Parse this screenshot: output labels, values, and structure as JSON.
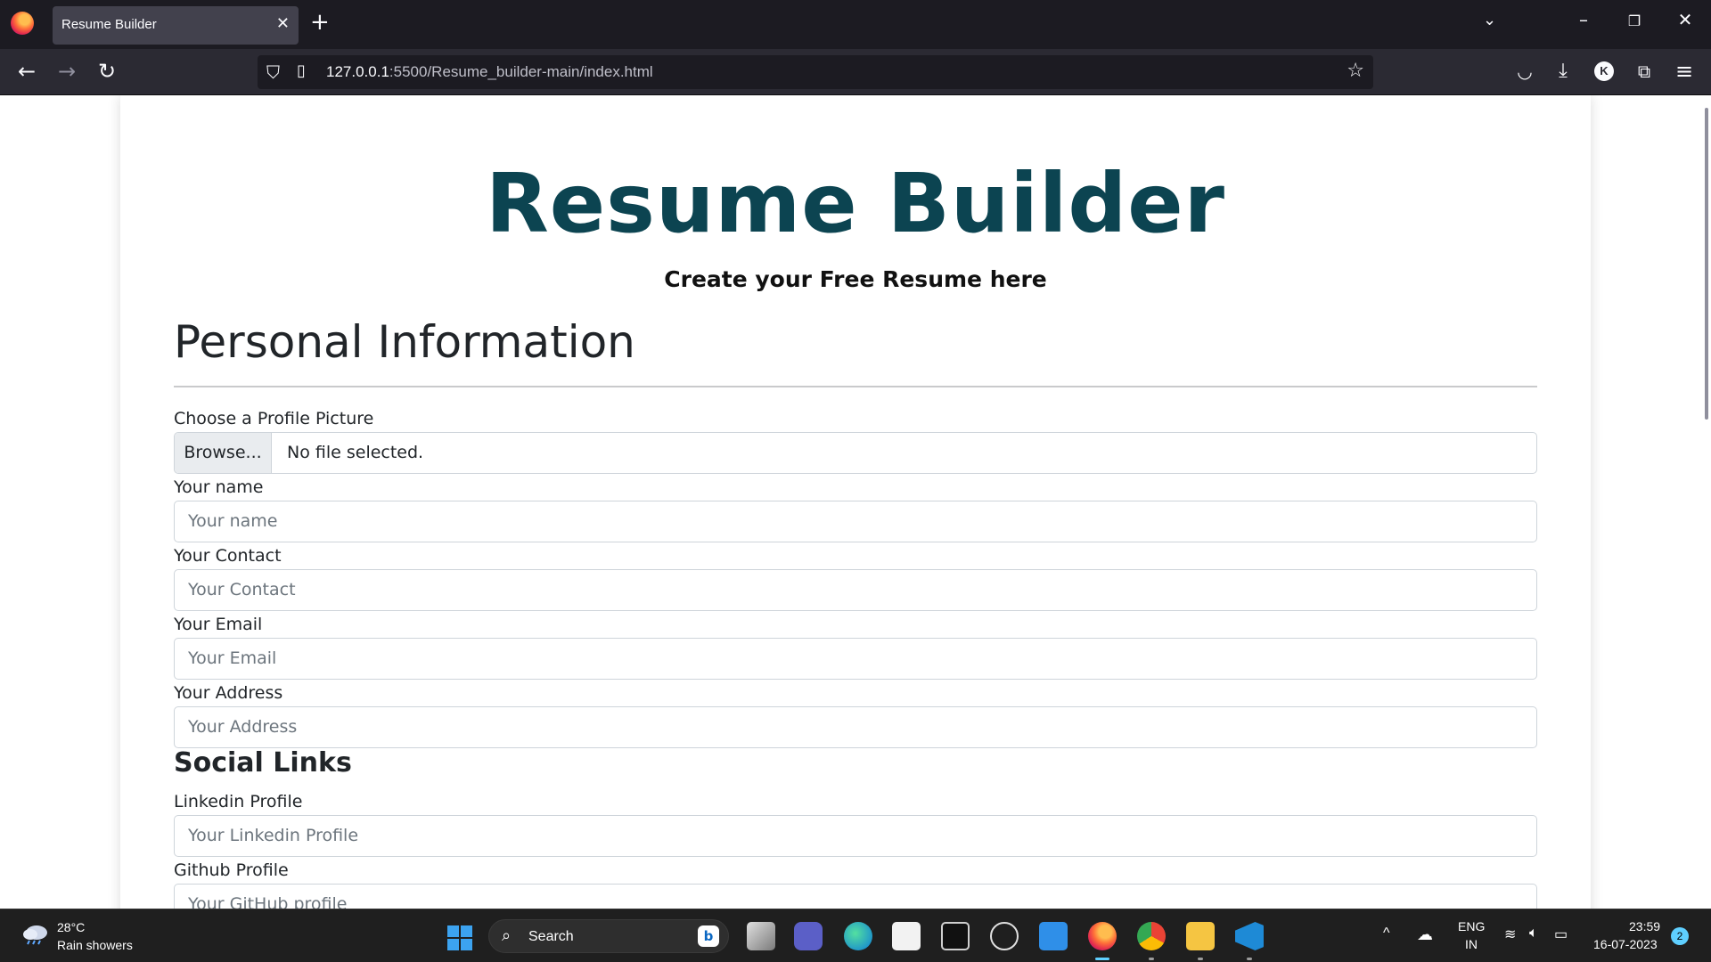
{
  "browser": {
    "tab_title": "Resume Builder",
    "url_host": "127.0.0.1",
    "url_rest": ":5500/Resume_builder-main/index.html"
  },
  "page": {
    "title": "Resume Builder",
    "subtitle": "Create your Free Resume here",
    "section_personal": "Personal Information",
    "profile_pic_label": "Choose a Profile Picture",
    "browse_label": "Browse...",
    "file_status": "No file selected.",
    "name_label": "Your name",
    "name_placeholder": "Your name",
    "contact_label": "Your Contact",
    "contact_placeholder": "Your Contact",
    "email_label": "Your Email",
    "email_placeholder": "Your Email",
    "address_label": "Your Address",
    "address_placeholder": "Your Address",
    "section_social": "Social Links",
    "linkedin_label": "Linkedin Profile",
    "linkedin_placeholder": "Your Linkedin Profile",
    "github_label": "Github Profile",
    "github_placeholder": "Your GitHub profile"
  },
  "taskbar": {
    "weather_temp": "28°C",
    "weather_desc": "Rain showers",
    "search_label": "Search",
    "lang_top": "ENG",
    "lang_bottom": "IN",
    "time": "23:59",
    "date": "16-07-2023",
    "notification_count": "2"
  },
  "colors": {
    "title": "#0c4451",
    "accent": "#5fcfff"
  }
}
